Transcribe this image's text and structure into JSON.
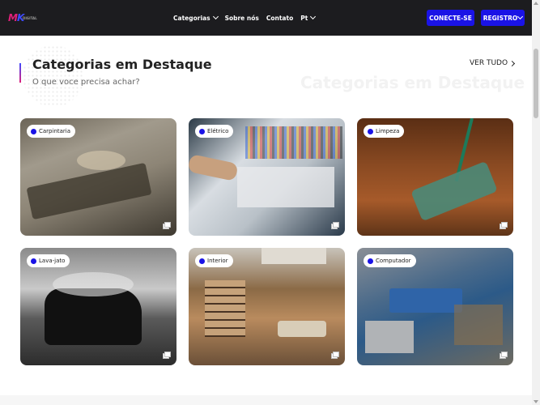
{
  "brand": {
    "mark_m": "M",
    "mark_k": "K",
    "tagline": "DIGITAL"
  },
  "nav": {
    "items": [
      "Categorias",
      "Sobre nós",
      "Contato",
      "Pt"
    ],
    "login_label": "CONECTE-SE",
    "register_label": "REGISTRO"
  },
  "section": {
    "title": "Categorias em Destaque",
    "subtitle": "O que voce precisa achar?",
    "watermark": "Categorias em Destaque",
    "see_all": "VER TUDO"
  },
  "categories": [
    {
      "label": "Carpintaria",
      "icon": "gallery-icon"
    },
    {
      "label": "Elétrico",
      "icon": "gallery-icon"
    },
    {
      "label": "Limpeza",
      "icon": "gallery-icon"
    },
    {
      "label": "Lava-jato",
      "icon": "gallery-icon"
    },
    {
      "label": "Interior",
      "icon": "gallery-icon"
    },
    {
      "label": "Computador",
      "icon": "gallery-icon"
    }
  ],
  "colors": {
    "accent": "#1a13e6",
    "brand_pink": "#e0207a",
    "topbar": "#1c1c1f"
  }
}
